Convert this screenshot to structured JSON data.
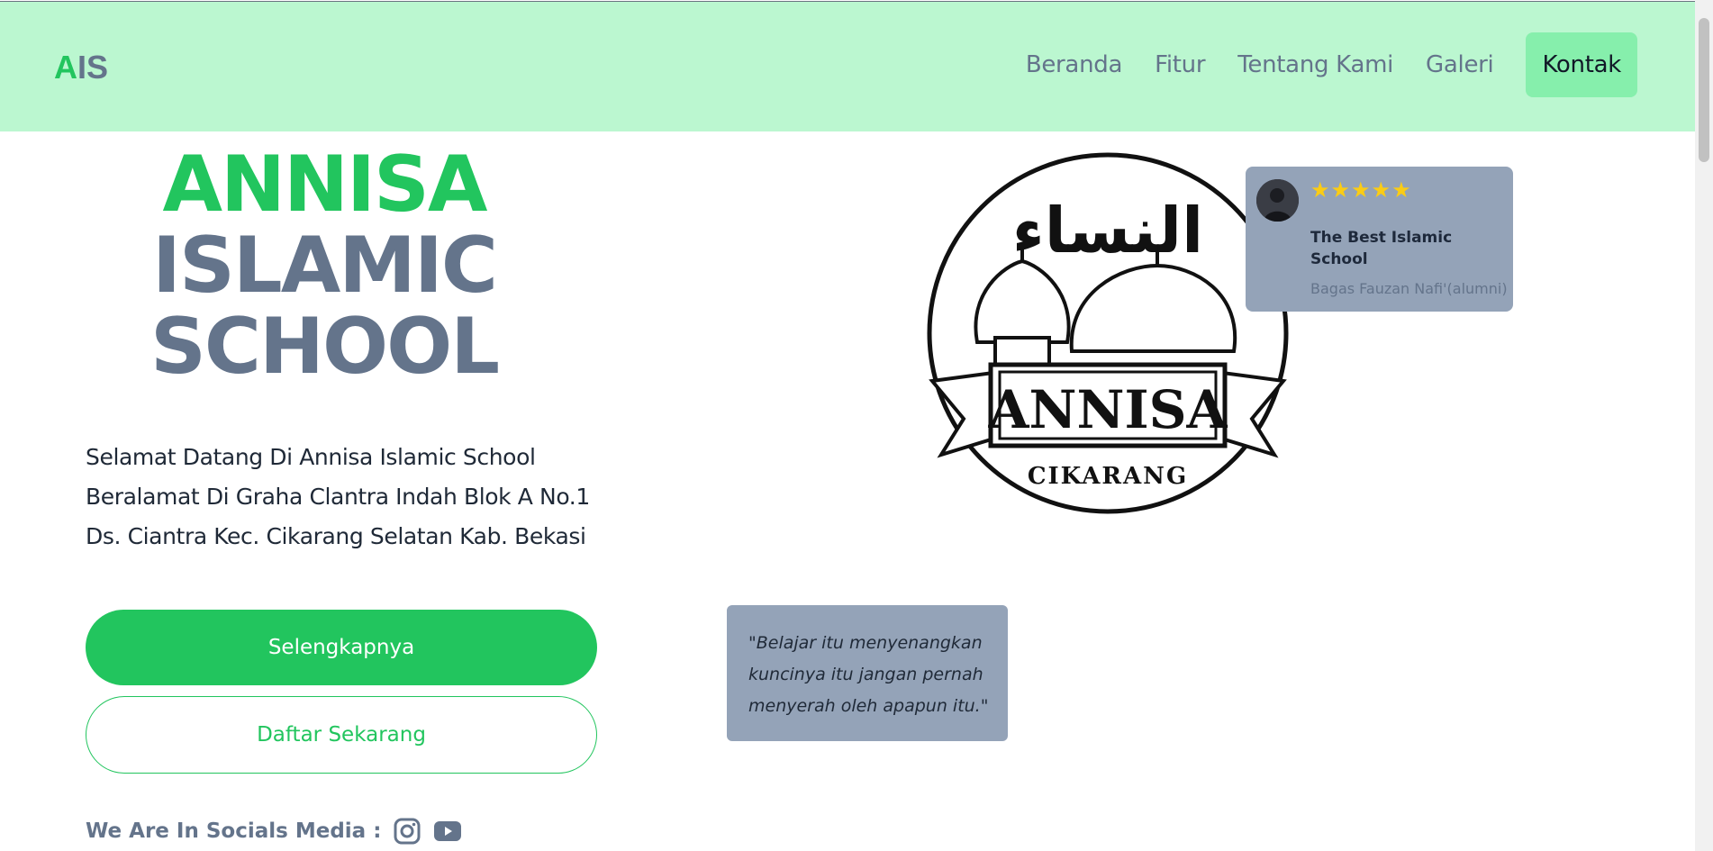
{
  "navbar": {
    "brand_a": "A",
    "brand_rest": "IS",
    "links": [
      "Beranda",
      "Fitur",
      "Tentang Kami",
      "Galeri"
    ],
    "contact_label": "Kontak"
  },
  "hero": {
    "title_line1": "ANNISA",
    "title_line2": "ISLAMIC",
    "title_line3": "SCHOOL",
    "welcome_lines": [
      "Selamat Datang Di Annisa Islamic School",
      "Beralamat Di Graha Clantra Indah Blok A No.1",
      "Ds. Ciantra Kec. Cikarang Selatan Kab. Bekasi"
    ],
    "primary_button": "Selengkapnya",
    "secondary_button": "Daftar Sekarang",
    "socials_label": "We Are In Socials Media :",
    "social_icons": [
      "instagram-icon",
      "youtube-icon"
    ]
  },
  "logo": {
    "arabic_text": "النساء",
    "banner_text": "ANNISA",
    "city_text": "CIKARANG"
  },
  "review": {
    "stars": 5,
    "stars_text": "★★★★★",
    "title": "The Best Islamic School",
    "author": "Bagas Fauzan Nafi'(alumni)"
  },
  "quote": {
    "text": "\"Belajar itu menyenangkan kuncinya itu jangan pernah menyerah oleh apapun itu.\""
  },
  "colors": {
    "navbar_bg": "#bbf7d0",
    "accent_green": "#22c55e",
    "slate": "#64748b",
    "card_bg": "#94a3b8",
    "star": "#facc15"
  }
}
